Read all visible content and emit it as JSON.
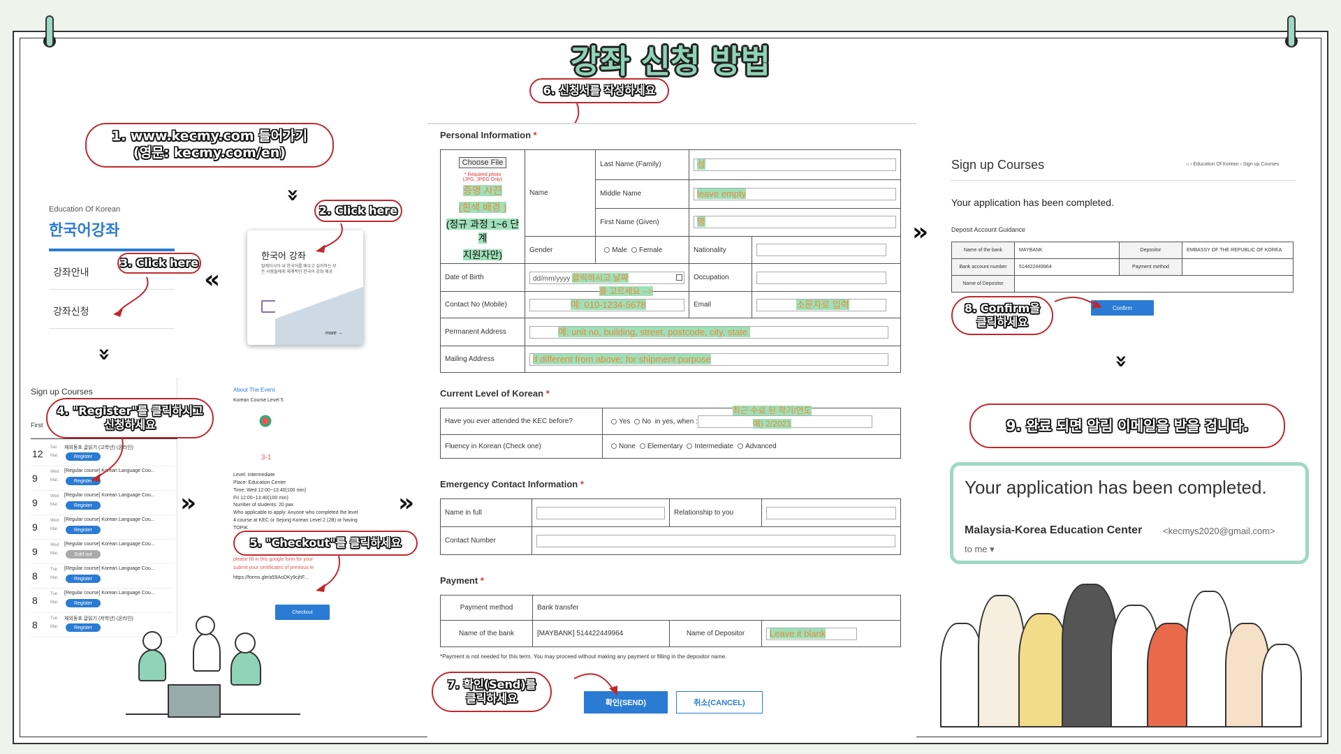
{
  "title": "강좌 신청 방법",
  "steps": {
    "s1": "1. www.kecmy.com 들어가기\n(영문: kecmy.com/en)",
    "s2": "2. Click here",
    "s3": "3. Click here",
    "s4": "4. \"Register\"를 클릭하시고\n신청하세요",
    "s5": "5. \"Checkout\"를 클릭하세요",
    "s6": "6. 신청서를 작성하세요",
    "s7": "7. 확인(Send)를\n클릭하세요",
    "s8": "8. Confirm을\n클릭하세요",
    "s9": "9. 완료 되면 알림 이메일을 받을 겁니다."
  },
  "panel1": {
    "small_title": "Education Of Korean",
    "big_title": "한국어강좌",
    "menu1": "강좌안내",
    "menu2": "강좌신청",
    "card_title": "한국어 강좌",
    "card_desc": "말레이시아 내 한국어를 배우고 싶어하는 모든 사람들에게 체계적인 한국어 강좌 제공",
    "card_more": "more →"
  },
  "panel2": {
    "title": "Sign up Courses",
    "first": "First",
    "register": "Register",
    "soldout": "Sold out",
    "rows": [
      {
        "day": "12",
        "dow": "Sat",
        "mon": "Mar.",
        "text": "재외동포 글읽기 (고학년) (온라인)",
        "status": "register"
      },
      {
        "day": "9",
        "dow": "Wed",
        "mon": "Mar.",
        "text": "[Regular course] Korean Language Cou...",
        "status": "register"
      },
      {
        "day": "9",
        "dow": "Wed",
        "mon": "Mar.",
        "text": "[Regular course] Korean Language Cou...",
        "status": "register"
      },
      {
        "day": "9",
        "dow": "Wed",
        "mon": "Mar.",
        "text": "[Regular course] Korean Language Cou...",
        "status": "register"
      },
      {
        "day": "9",
        "dow": "Wed",
        "mon": "Mar.",
        "text": "[Regular course] Korean Language Cou...",
        "status": "soldout"
      },
      {
        "day": "8",
        "dow": "Tue",
        "mon": "Mar.",
        "text": "[Regular course] Korean Language Cou...",
        "status": "register"
      },
      {
        "day": "8",
        "dow": "Tue",
        "mon": "Mar.",
        "text": "[Regular course] Korean Language Cou...",
        "status": "register"
      },
      {
        "day": "8",
        "dow": "Tue",
        "mon": "Mar.",
        "text": "재외동포 글읽기 (저학년) (온라인)",
        "status": "register"
      }
    ]
  },
  "panel3": {
    "about": "About The Event",
    "level": "Korean Course Level 5",
    "level_num": "3-1",
    "details": [
      "Level: Intermediate",
      "Place: Education Center",
      "Time: Wed 12:00~13:40(100 min)",
      "Fri 12:00~13:40(100 min)",
      "Number of students: 20 pax",
      "Who applicable to apply: Anyone who completed the level",
      "4 course at KEC or Sejong Korean Level 2 (2B) or having",
      "TOPIK"
    ],
    "red1": "please fill in this google form for your",
    "red2": "submit your certificates of previous le",
    "link": "https://forms.gle/a59AoDKy9cjhF...",
    "checkout": "Checkout"
  },
  "form": {
    "personal_info": "Personal Information",
    "choose_file": "Choose File",
    "required_photo": "* Required photo (JPG, JPEG Only)",
    "photo_note1": "증명 사진",
    "photo_note2": "(흰색 배경 )",
    "photo_note3": "(정규 과정 1~6 단계",
    "photo_note4": "지원자만)",
    "name": "Name",
    "last_name": "Last Name (Family)",
    "last_name_val": "성",
    "middle_name": "Middle Name",
    "middle_name_val": "leave empty",
    "first_name": "First Name (Given)",
    "first_name_val": "명",
    "gender": "Gender",
    "male": "Male",
    "female": "Female",
    "nationality": "Nationality",
    "dob": "Date of Birth",
    "dob_placeholder": "dd/mm/yyyy",
    "dob_note1": "클릭하시고 날짜",
    "dob_note2": "를 고르세요 -->",
    "occupation": "Occupation",
    "contact": "Contact No (Mobile)",
    "contact_val": "예: 010-1234-5678",
    "email": "Email",
    "email_val": "소문자로 입력",
    "permanent": "Permanent Address",
    "permanent_val": "예: unit no, building, street, postcode, city, state.",
    "mailing": "Mailing Address",
    "mailing_val": "if different from above; for shipment purpose",
    "current_level": "Current Level of Korean",
    "attended": "Have you ever attended the KEC before?",
    "yes": "Yes",
    "no": "No",
    "when": "in yes, when :",
    "when_note1": "최근 수료 된 학기/연도",
    "when_note2": "예) 2/2021",
    "fluency": "Fluency in Korean (Check one)",
    "none": "None",
    "elementary": "Elementary",
    "intermediate": "Intermediate",
    "advanced": "Advanced",
    "emergency": "Emergency Contact Information",
    "name_full": "Name in full",
    "relationship": "Relationship to you",
    "contact_number": "Contact Number",
    "payment": "Payment",
    "payment_method": "Payment method",
    "bank_transfer": "Bank transfer",
    "bank_name": "Name of the bank",
    "bank_val": "[MAYBANK] 514422449964",
    "depositor": "Name of Depositor",
    "depositor_val": "Leave it blank",
    "note": "*Payment is not needed for this term. You may proceed without making any payment or filling in the depositor name.",
    "send": "확인(SEND)",
    "cancel": "취소(CANCEL)"
  },
  "panel5": {
    "title": "Sign up Courses",
    "breadcrumb1": "Education Of Korean",
    "breadcrumb2": "Sign up Courses",
    "completed": "Your application has been completed.",
    "deposit": "Deposit Account Guidance",
    "bank_label": "Name of the bank",
    "bank": "MAYBANK",
    "depositor_label": "Depositor",
    "depositor": "EMBASSY OF THE REPUBLIC OF KOREA",
    "account_label": "Bank account number",
    "account": "514422449964",
    "method_label": "Payment method",
    "name_depositor_label": "Name of Depositor",
    "confirm": "Confirm"
  },
  "email": {
    "subject": "Your application has been completed.",
    "sender": "Malaysia-Korea Education Center",
    "address": "<kecmys2020@gmail.com>",
    "to": "to me"
  },
  "colors": {
    "accent": "#2a7bd3",
    "callout_border": "#c0272d",
    "mint": "#8fd3b8",
    "highlight": "#9ee0b8"
  }
}
